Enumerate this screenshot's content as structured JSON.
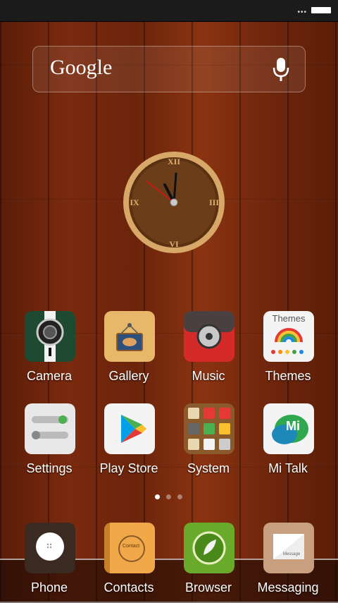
{
  "search": {
    "label": "Google"
  },
  "clock": {
    "n12": "XII",
    "n3": "III",
    "n6": "VI",
    "n9": "IX"
  },
  "apps_row1": [
    {
      "label": "Camera"
    },
    {
      "label": "Gallery"
    },
    {
      "label": "Music"
    },
    {
      "label": "Themes",
      "icon_text": "Themes"
    }
  ],
  "apps_row2": [
    {
      "label": "Settings"
    },
    {
      "label": "Play Store"
    },
    {
      "label": "System"
    },
    {
      "label": "Mi Talk",
      "icon_text": "Mi"
    }
  ],
  "dock": [
    {
      "label": "Phone"
    },
    {
      "label": "Contacts",
      "icon_text": "Contact"
    },
    {
      "label": "Browser"
    },
    {
      "label": "Messaging",
      "icon_text": "Message"
    }
  ],
  "page_indicator": {
    "active": 1,
    "count": 3
  }
}
